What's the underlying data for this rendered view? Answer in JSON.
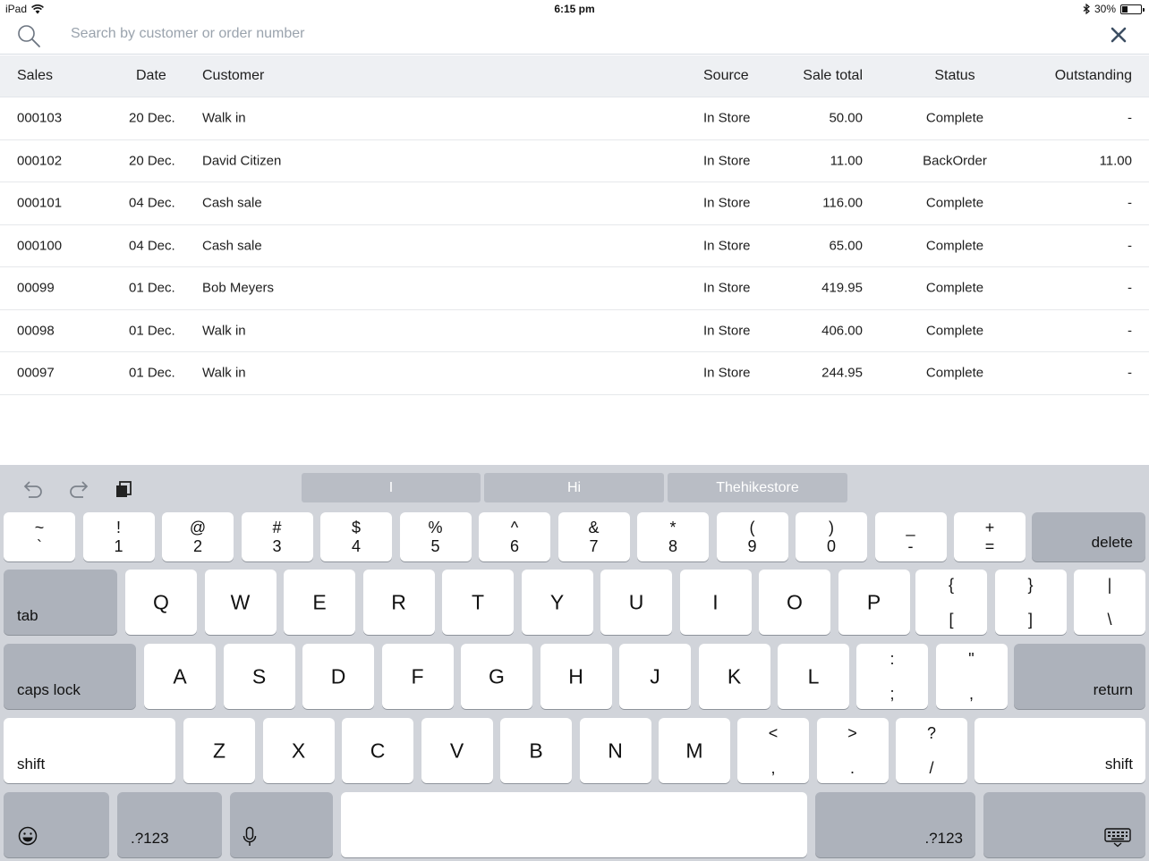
{
  "status_bar": {
    "device": "iPad",
    "time": "6:15 pm",
    "battery_percent": "30%",
    "battery_level": 0.3
  },
  "search": {
    "placeholder": "Search by customer or order number",
    "value": ""
  },
  "table": {
    "headers": {
      "sales": "Sales",
      "date": "Date",
      "customer": "Customer",
      "source": "Source",
      "sale_total": "Sale total",
      "status": "Status",
      "outstanding": "Outstanding"
    },
    "rows": [
      {
        "sales": "000103",
        "date": "20 Dec.",
        "customer": "Walk in",
        "source": "In Store",
        "total": "50.00",
        "status": "Complete",
        "outstanding": "-"
      },
      {
        "sales": "000102",
        "date": "20 Dec.",
        "customer": "David Citizen",
        "source": "In Store",
        "total": "11.00",
        "status": "BackOrder",
        "outstanding": "11.00"
      },
      {
        "sales": "000101",
        "date": "04 Dec.",
        "customer": "Cash sale",
        "source": "In Store",
        "total": "116.00",
        "status": "Complete",
        "outstanding": "-"
      },
      {
        "sales": "000100",
        "date": "04 Dec.",
        "customer": "Cash sale",
        "source": "In Store",
        "total": "65.00",
        "status": "Complete",
        "outstanding": "-"
      },
      {
        "sales": "00099",
        "date": "01 Dec.",
        "customer": "Bob Meyers",
        "source": "In Store",
        "total": "419.95",
        "status": "Complete",
        "outstanding": "-"
      },
      {
        "sales": "00098",
        "date": "01 Dec.",
        "customer": "Walk in",
        "source": "In Store",
        "total": "406.00",
        "status": "Complete",
        "outstanding": "-"
      },
      {
        "sales": "00097",
        "date": "01 Dec.",
        "customer": "Walk in",
        "source": "In Store",
        "total": "244.95",
        "status": "Complete",
        "outstanding": "-"
      }
    ]
  },
  "keyboard": {
    "suggestions": [
      "I",
      "Hi",
      "Thehikestore"
    ],
    "number_row": [
      {
        "top": "~",
        "bot": "`"
      },
      {
        "top": "!",
        "bot": "1"
      },
      {
        "top": "@",
        "bot": "2"
      },
      {
        "top": "#",
        "bot": "3"
      },
      {
        "top": "$",
        "bot": "4"
      },
      {
        "top": "%",
        "bot": "5"
      },
      {
        "top": "^",
        "bot": "6"
      },
      {
        "top": "&",
        "bot": "7"
      },
      {
        "top": "*",
        "bot": "8"
      },
      {
        "top": "(",
        "bot": "9"
      },
      {
        "top": ")",
        "bot": "0"
      },
      {
        "top": "_",
        "bot": "-"
      },
      {
        "top": "+",
        "bot": "="
      }
    ],
    "delete": "delete",
    "tab": "tab",
    "row_q": [
      "Q",
      "W",
      "E",
      "R",
      "T",
      "Y",
      "U",
      "I",
      "O",
      "P"
    ],
    "row_q_symbols": [
      {
        "top": "{",
        "bot": "["
      },
      {
        "top": "}",
        "bot": "]"
      },
      {
        "top": "|",
        "bot": "\\"
      }
    ],
    "caps_lock": "caps lock",
    "row_a": [
      "A",
      "S",
      "D",
      "F",
      "G",
      "H",
      "J",
      "K",
      "L"
    ],
    "row_a_symbols": [
      {
        "top": ":",
        "bot": ";"
      },
      {
        "top": "\"",
        "bot": ","
      }
    ],
    "return": "return",
    "shift": "shift",
    "row_z": [
      "Z",
      "X",
      "C",
      "V",
      "B",
      "N",
      "M"
    ],
    "row_z_symbols": [
      {
        "top": "<",
        "bot": ","
      },
      {
        "top": ">",
        "bot": "."
      },
      {
        "top": "?",
        "bot": "/"
      }
    ],
    "numbers_key": ".?123"
  }
}
